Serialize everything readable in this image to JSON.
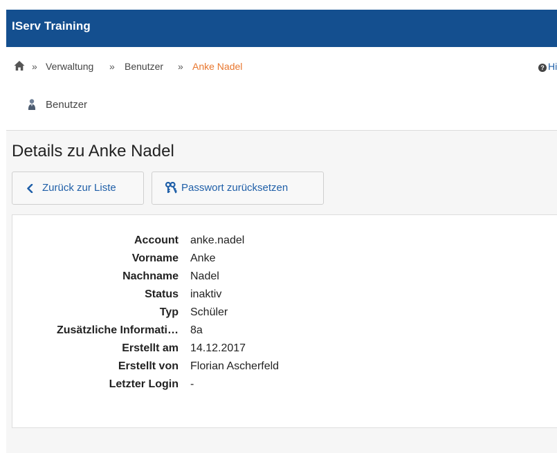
{
  "app": {
    "title": "IServ Training"
  },
  "breadcrumb": {
    "separator": "»",
    "items": [
      "Verwaltung",
      "Benutzer"
    ],
    "current": "Anke Nadel",
    "help_label": "Hilfe",
    "help_icon": "?"
  },
  "module": {
    "label": "Benutzer"
  },
  "page": {
    "title": "Details zu Anke Nadel"
  },
  "buttons": {
    "back_label": "Zurück zur Liste",
    "reset_label": "Passwort zurücksetzen"
  },
  "details": [
    {
      "key": "Account",
      "value": "anke.nadel"
    },
    {
      "key": "Vorname",
      "value": "Anke"
    },
    {
      "key": "Nachname",
      "value": "Nadel"
    },
    {
      "key": "Status",
      "value": "inaktiv"
    },
    {
      "key": "Typ",
      "value": "Schüler"
    },
    {
      "key": "Zusätzliche Informati…",
      "value": "8a"
    },
    {
      "key": "Erstellt am",
      "value": "14.12.2017"
    },
    {
      "key": "Erstellt von",
      "value": "Florian Ascherfeld"
    },
    {
      "key": "Letzter Login",
      "value": "-"
    }
  ],
  "colors": {
    "brand": "#144f8f",
    "link": "#1f5fa8",
    "current_crumb": "#e8762d"
  }
}
